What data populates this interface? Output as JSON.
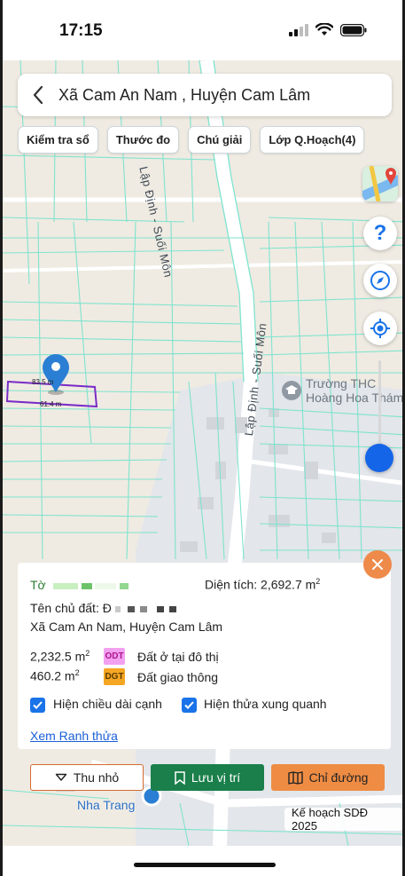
{
  "status": {
    "time": "17:15"
  },
  "header": {
    "title": "Xã Cam An Nam , Huyện Cam Lâm"
  },
  "toolbar": {
    "items": [
      "Kiểm tra sổ",
      "Thước đo",
      "Chú giải",
      "Lớp Q.Hoạch(4)"
    ]
  },
  "map": {
    "road_label": "Lập Định - Suối Môn",
    "poi_label_line1": "Trường THC",
    "poi_label_line2": "Hoàng Hoa Thám",
    "edge_top": "83.5 m",
    "edge_bottom": "61.4 m",
    "bottom_place": "Nha Trang",
    "colors": {
      "parcel_lines": "#7fe3cf",
      "map_bg": "#efebe2",
      "plot_outline": "#7a2cc7",
      "pin": "#2a7fd4"
    }
  },
  "panel": {
    "to_label": "Tờ",
    "area_label": "Diện tích: 2,692.7 m",
    "area_sup": "2",
    "owner_label": "Tên chủ đất: Đ",
    "address": "Xã Cam An Nam, Huyện Cam Lâm",
    "land_uses": [
      {
        "area": "2,232.5 m",
        "sup": "2",
        "code": "ODT",
        "desc": "Đất ở tại đô thị",
        "color": "#f2a1f0"
      },
      {
        "area": "460.2 m",
        "sup": "2",
        "code": "DGT",
        "desc": "Đất giao thông",
        "color": "#f5a623"
      }
    ],
    "check_edges": "Hiện chiều dài cạnh",
    "check_neighbors": "Hiện thửa xung quanh",
    "link_boundary": "Xem Ranh thửa"
  },
  "actions": {
    "collapse": "Thu nhỏ",
    "save": "Lưu vị trí",
    "route": "Chỉ đường"
  },
  "plan_label": "Kế hoạch SDĐ 2025",
  "icons": [
    "back-arrow-icon",
    "map-layers-icon",
    "help-icon",
    "compass-icon",
    "locate-icon",
    "close-icon",
    "chevron-down-icon",
    "bookmark-icon",
    "map-icon",
    "checkbox-checked-icon",
    "location-pin-icon",
    "school-icon"
  ]
}
